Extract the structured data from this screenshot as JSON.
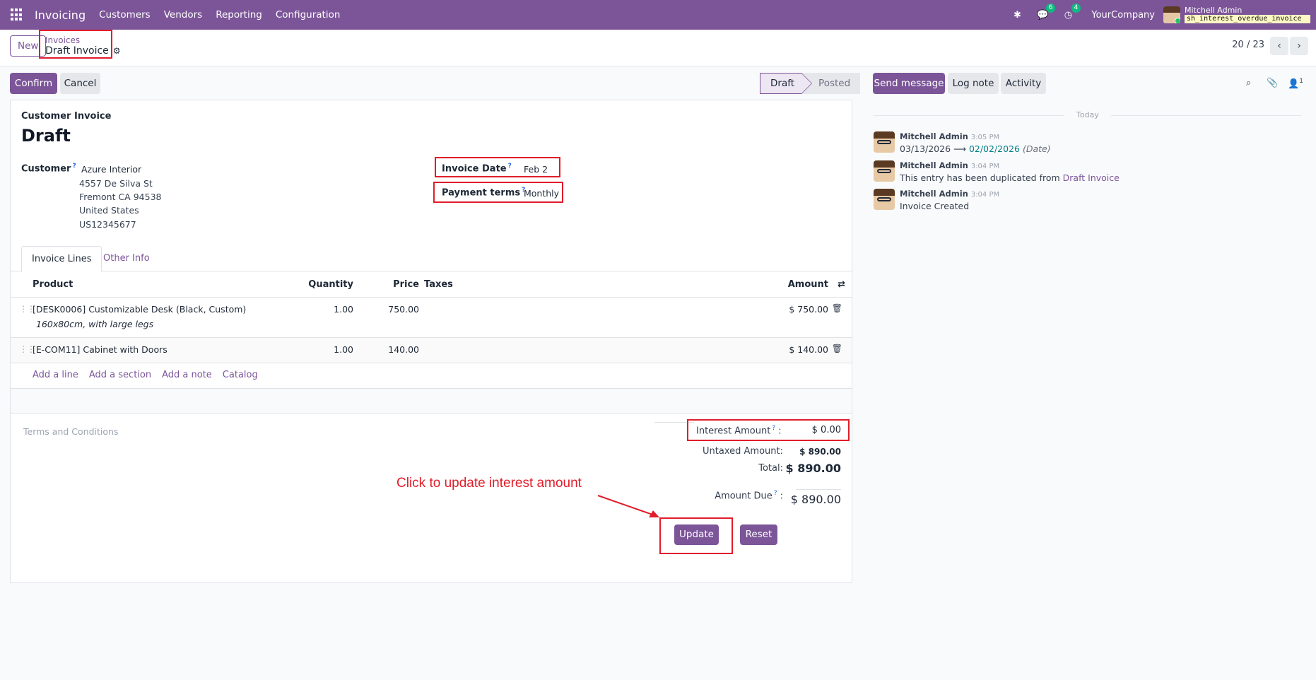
{
  "navbar": {
    "app_name": "Invoicing",
    "menu": [
      "Customers",
      "Vendors",
      "Reporting",
      "Configuration"
    ],
    "messages_count": "6",
    "activities_count": "4",
    "company": "YourCompany",
    "user_name": "Mitchell Admin",
    "database": "sh_interest_overdue_invoice"
  },
  "control": {
    "new_label": "New",
    "breadcrumb_parent": "Invoices",
    "breadcrumb_current": "Draft Invoice",
    "pager": "20 / 23"
  },
  "actions": {
    "confirm": "Confirm",
    "cancel": "Cancel",
    "status_draft": "Draft",
    "status_posted": "Posted"
  },
  "form": {
    "type_label": "Customer Invoice",
    "title": "Draft",
    "customer_label": "Customer",
    "customer_name": "Azure Interior",
    "address": [
      "4557 De Silva St",
      "Fremont CA 94538",
      "United States",
      "US12345677"
    ],
    "invoice_date_label": "Invoice Date",
    "invoice_date": "Feb 2",
    "payment_terms_label": "Payment terms",
    "payment_terms": "Monthly",
    "tooltip_mark": "?"
  },
  "tabs": [
    "Invoice Lines",
    "Other Info"
  ],
  "lines": {
    "headers": {
      "product": "Product",
      "quantity": "Quantity",
      "price": "Price",
      "taxes": "Taxes",
      "amount": "Amount"
    },
    "rows": [
      {
        "product": "[DESK0006] Customizable Desk (Black, Custom)",
        "description": "160x80cm, with large legs",
        "quantity": "1.00",
        "price": "750.00",
        "amount": "$ 750.00"
      },
      {
        "product": "[E-COM11] Cabinet with Doors",
        "description": "",
        "quantity": "1.00",
        "price": "140.00",
        "amount": "$ 140.00"
      }
    ],
    "add_links": [
      "Add a line",
      "Add a section",
      "Add a note",
      "Catalog"
    ]
  },
  "totals": {
    "terms_placeholder": "Terms and Conditions",
    "interest_label": "Interest Amount",
    "interest_value": "$ 0.00",
    "untaxed_label": "Untaxed Amount:",
    "untaxed_value": "$ 890.00",
    "total_label": "Total:",
    "total_value": "$ 890.00",
    "due_label": "Amount Due",
    "due_value": "$ 890.00",
    "update": "Update",
    "reset": "Reset"
  },
  "annotation": "Click to update interest amount",
  "chatter": {
    "send_message": "Send message",
    "log_note": "Log note",
    "activity": "Activity",
    "followers": "1",
    "day_separator": "Today",
    "messages": [
      {
        "author": "Mitchell Admin",
        "time": "3:05 PM",
        "old": "03/13/2026",
        "new": "02/02/2026",
        "field": "(Date)"
      },
      {
        "author": "Mitchell Admin",
        "time": "3:04 PM",
        "text": "This entry has been duplicated from ",
        "link": "Draft Invoice"
      },
      {
        "author": "Mitchell Admin",
        "time": "3:04 PM",
        "text": "Invoice Created"
      }
    ]
  },
  "colors": {
    "brand": "#7c5599",
    "highlight": "#e11d2a",
    "badge": "#10b981"
  }
}
